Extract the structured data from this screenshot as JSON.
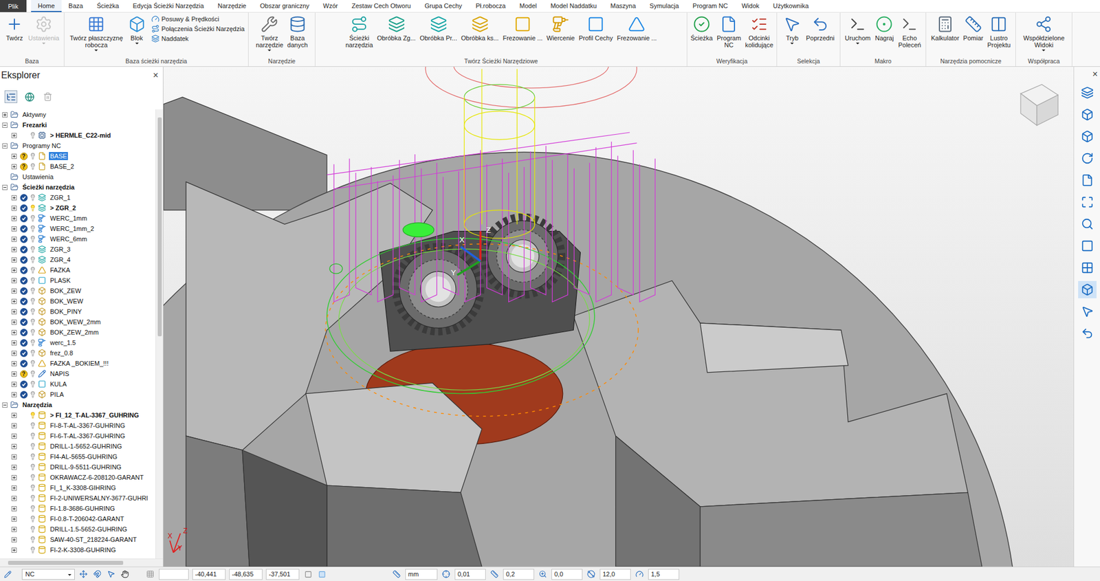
{
  "menu": {
    "file": "Plik",
    "tabs": [
      {
        "label": "Home",
        "selected": true
      },
      {
        "label": "Baza",
        "selected": false
      },
      {
        "label": "Ścieżka",
        "selected": false
      },
      {
        "label": "Edycja Ścieżki Narzędzia",
        "selected": false
      },
      {
        "label": "Narzędzie",
        "selected": false
      },
      {
        "label": "Obszar graniczny",
        "selected": false
      },
      {
        "label": "Wzór",
        "selected": false
      },
      {
        "label": "Zestaw Cech Otworu",
        "selected": false
      },
      {
        "label": "Grupa Cechy",
        "selected": false
      },
      {
        "label": "Pł.robocza",
        "selected": false
      },
      {
        "label": "Model",
        "selected": false
      },
      {
        "label": "Model Naddatku",
        "selected": false
      },
      {
        "label": "Maszyna",
        "selected": false
      },
      {
        "label": "Symulacja",
        "selected": false
      },
      {
        "label": "Program NC",
        "selected": false
      },
      {
        "label": "Widok",
        "selected": false
      },
      {
        "label": "Użytkownika",
        "selected": false
      }
    ]
  },
  "ribbon": {
    "groups": [
      {
        "title": "Baza",
        "buttons": [
          {
            "label": "Twórz",
            "disabled": false,
            "dropdown": false
          },
          {
            "label": "Ustawienia",
            "disabled": true,
            "dropdown": true
          }
        ],
        "small": []
      },
      {
        "title": "Baza ścieżki narzędzia",
        "buttons": [
          {
            "label": "Twórz płaszczyznę\nrobocza",
            "disabled": false,
            "dropdown": true
          },
          {
            "label": "Blok",
            "disabled": false,
            "dropdown": true
          }
        ],
        "small": [
          "Posuwy & Prędkości",
          "Połączenia Ścieżki Narzędzia",
          "Naddatek"
        ]
      },
      {
        "title": "Narzędzie",
        "buttons": [
          {
            "label": "Twórz\nnarzędzie",
            "disabled": false,
            "dropdown": true
          },
          {
            "label": "Baza\ndanych",
            "disabled": false,
            "dropdown": false
          }
        ],
        "small": []
      },
      {
        "title": "Twórz Ścieżki Narzędziowe",
        "buttons": [
          {
            "label": "Ścieżki\nnarzędzia",
            "disabled": false,
            "dropdown": false
          },
          {
            "label": "Obróbka Zg...",
            "disabled": false,
            "dropdown": false
          },
          {
            "label": "Obróbka Pr...",
            "disabled": false,
            "dropdown": false
          },
          {
            "label": "Obróbka ks...",
            "disabled": false,
            "dropdown": false
          },
          {
            "label": "Frezowanie ...",
            "disabled": false,
            "dropdown": false
          },
          {
            "label": "Wiercenie",
            "disabled": false,
            "dropdown": false
          },
          {
            "label": "Profil Cechy",
            "disabled": false,
            "dropdown": false
          },
          {
            "label": "Frezowanie ...",
            "disabled": false,
            "dropdown": false
          }
        ],
        "small": []
      },
      {
        "title": "Weryfikacja",
        "buttons": [
          {
            "label": "Ścieżka",
            "disabled": false,
            "dropdown": false
          },
          {
            "label": "Program\nNC",
            "disabled": false,
            "dropdown": false
          },
          {
            "label": "Odcinki\nkolidujące",
            "disabled": false,
            "dropdown": false
          }
        ],
        "small": []
      },
      {
        "title": "Selekcja",
        "buttons": [
          {
            "label": "Tryb",
            "disabled": false,
            "dropdown": true
          },
          {
            "label": "Poprzedni",
            "disabled": false,
            "dropdown": false
          }
        ],
        "small": []
      },
      {
        "title": "Makro",
        "buttons": [
          {
            "label": "Uruchom",
            "disabled": false,
            "dropdown": true
          },
          {
            "label": "Nagraj",
            "disabled": false,
            "dropdown": false
          },
          {
            "label": "Echo\nPoleceń",
            "disabled": false,
            "dropdown": false
          }
        ],
        "small": []
      },
      {
        "title": "Narzędzia pomocnicze",
        "buttons": [
          {
            "label": "Kalkulator",
            "disabled": false,
            "dropdown": false
          },
          {
            "label": "Pomiar",
            "disabled": false,
            "dropdown": false
          },
          {
            "label": "Lustro\nProjektu",
            "disabled": false,
            "dropdown": false
          }
        ],
        "small": []
      },
      {
        "title": "Współpraca",
        "buttons": [
          {
            "label": "Współdzielone\nWidoki",
            "disabled": false,
            "dropdown": true
          }
        ],
        "small": []
      }
    ]
  },
  "explorer": {
    "title": "Eksplorer",
    "close": "×",
    "items": [
      {
        "label": "Aktywny",
        "level": 0,
        "kind": "folder",
        "expandable": true,
        "expanded": false,
        "bold": false,
        "selected": false,
        "status": "none",
        "mark": "",
        "lit": false
      },
      {
        "label": "Frezarki",
        "level": 0,
        "kind": "folder",
        "expandable": true,
        "expanded": true,
        "bold": true,
        "selected": false,
        "status": "none",
        "mark": "",
        "lit": false
      },
      {
        "label": "> HERMLE_C22-mid",
        "level": 1,
        "kind": "machine",
        "expandable": true,
        "expanded": false,
        "bold": true,
        "selected": false,
        "status": "none",
        "mark": "",
        "lit": false
      },
      {
        "label": "Programy NC",
        "level": 0,
        "kind": "folder",
        "expandable": true,
        "expanded": true,
        "bold": false,
        "selected": false,
        "status": "none",
        "mark": "",
        "lit": false
      },
      {
        "label": "BASE",
        "level": 1,
        "kind": "program",
        "expandable": true,
        "expanded": false,
        "bold": false,
        "selected": true,
        "status": "unknown",
        "mark": "?",
        "lit": false
      },
      {
        "label": "BASE_2",
        "level": 1,
        "kind": "program",
        "expandable": true,
        "expanded": false,
        "bold": false,
        "selected": false,
        "status": "unknown",
        "mark": "?",
        "lit": false
      },
      {
        "label": "Ustawienia",
        "level": 0,
        "kind": "folder",
        "expandable": false,
        "expanded": false,
        "bold": false,
        "selected": false,
        "status": "none",
        "mark": "",
        "lit": false
      },
      {
        "label": "Ścieżki narzędzia",
        "level": 0,
        "kind": "folder",
        "expandable": true,
        "expanded": true,
        "bold": true,
        "selected": false,
        "status": "none",
        "mark": "",
        "lit": false
      },
      {
        "label": "ZGR_1",
        "level": 1,
        "kind": "toolpath",
        "expandable": true,
        "expanded": false,
        "bold": false,
        "selected": false,
        "status": "ok",
        "mark": "",
        "lit": false
      },
      {
        "label": "> ZGR_2",
        "level": 1,
        "kind": "toolpath",
        "expandable": true,
        "expanded": false,
        "bold": true,
        "selected": false,
        "status": "ok",
        "mark": "",
        "lit": true
      },
      {
        "label": "WERC_1mm",
        "level": 1,
        "kind": "drill",
        "expandable": true,
        "expanded": false,
        "bold": false,
        "selected": false,
        "status": "ok",
        "mark": "",
        "lit": false
      },
      {
        "label": "WERC_1mm_2",
        "level": 1,
        "kind": "drill",
        "expandable": true,
        "expanded": false,
        "bold": false,
        "selected": false,
        "status": "ok",
        "mark": "",
        "lit": false
      },
      {
        "label": "WERC_6mm",
        "level": 1,
        "kind": "drill",
        "expandable": true,
        "expanded": false,
        "bold": false,
        "selected": false,
        "status": "ok",
        "mark": "",
        "lit": false
      },
      {
        "label": "ZGR_3",
        "level": 1,
        "kind": "toolpath",
        "expandable": true,
        "expanded": false,
        "bold": false,
        "selected": false,
        "status": "ok",
        "mark": "",
        "lit": false
      },
      {
        "label": "ZGR_4",
        "level": 1,
        "kind": "toolpath",
        "expandable": true,
        "expanded": false,
        "bold": false,
        "selected": false,
        "status": "ok",
        "mark": "",
        "lit": false
      },
      {
        "label": "FAZKA",
        "level": 1,
        "kind": "chamfer",
        "expandable": true,
        "expanded": false,
        "bold": false,
        "selected": false,
        "status": "ok",
        "mark": "",
        "lit": false
      },
      {
        "label": "PLASK",
        "level": 1,
        "kind": "face",
        "expandable": true,
        "expanded": false,
        "bold": false,
        "selected": false,
        "status": "ok",
        "mark": "",
        "lit": false
      },
      {
        "label": "BOK_ZEW",
        "level": 1,
        "kind": "profile",
        "expandable": true,
        "expanded": false,
        "bold": false,
        "selected": false,
        "status": "ok",
        "mark": "",
        "lit": false
      },
      {
        "label": "BOK_WEW",
        "level": 1,
        "kind": "profile",
        "expandable": true,
        "expanded": false,
        "bold": false,
        "selected": false,
        "status": "ok",
        "mark": "",
        "lit": false
      },
      {
        "label": "BOK_PINY",
        "level": 1,
        "kind": "profile",
        "expandable": true,
        "expanded": false,
        "bold": false,
        "selected": false,
        "status": "ok",
        "mark": "",
        "lit": false
      },
      {
        "label": "BOK_WEW_2mm",
        "level": 1,
        "kind": "profile",
        "expandable": true,
        "expanded": false,
        "bold": false,
        "selected": false,
        "status": "ok",
        "mark": "",
        "lit": false
      },
      {
        "label": "BOK_ZEW_2mm",
        "level": 1,
        "kind": "profile",
        "expandable": true,
        "expanded": false,
        "bold": false,
        "selected": false,
        "status": "ok",
        "mark": "",
        "lit": false
      },
      {
        "label": "werc_1.5",
        "level": 1,
        "kind": "drill",
        "expandable": true,
        "expanded": false,
        "bold": false,
        "selected": false,
        "status": "ok",
        "mark": "",
        "lit": false
      },
      {
        "label": "frez_0.8",
        "level": 1,
        "kind": "profile",
        "expandable": true,
        "expanded": false,
        "bold": false,
        "selected": false,
        "status": "ok",
        "mark": "",
        "lit": false
      },
      {
        "label": "FAZKA _BOKIEM_!!!",
        "level": 1,
        "kind": "chamfer",
        "expandable": true,
        "expanded": false,
        "bold": false,
        "selected": false,
        "status": "ok",
        "mark": "",
        "lit": false
      },
      {
        "label": "NAPIS",
        "level": 1,
        "kind": "engrave",
        "expandable": true,
        "expanded": false,
        "bold": false,
        "selected": false,
        "status": "unknown",
        "mark": "?",
        "lit": false
      },
      {
        "label": "KULA",
        "level": 1,
        "kind": "face",
        "expandable": true,
        "expanded": false,
        "bold": false,
        "selected": false,
        "status": "ok",
        "mark": "",
        "lit": false
      },
      {
        "label": "PILA",
        "level": 1,
        "kind": "profile",
        "expandable": true,
        "expanded": false,
        "bold": false,
        "selected": false,
        "status": "ok",
        "mark": "",
        "lit": false
      },
      {
        "label": "Narzędzia",
        "level": 0,
        "kind": "folder",
        "expandable": true,
        "expanded": true,
        "bold": true,
        "selected": false,
        "status": "none",
        "mark": "",
        "lit": false
      },
      {
        "label": "> FI_12_T-AL-3367_GUHRING",
        "level": 1,
        "kind": "tool",
        "expandable": true,
        "expanded": false,
        "bold": true,
        "selected": false,
        "status": "none",
        "mark": "",
        "lit": true
      },
      {
        "label": "FI-8-T-AL-3367-GUHRING",
        "level": 1,
        "kind": "tool",
        "expandable": true,
        "expanded": false,
        "bold": false,
        "selected": false,
        "status": "none",
        "mark": "",
        "lit": false
      },
      {
        "label": "FI-6-T-AL-3367-GUHRING",
        "level": 1,
        "kind": "tool",
        "expandable": true,
        "expanded": false,
        "bold": false,
        "selected": false,
        "status": "none",
        "mark": "",
        "lit": false
      },
      {
        "label": "DRILL-1-5652-GUHRING",
        "level": 1,
        "kind": "tool",
        "expandable": true,
        "expanded": false,
        "bold": false,
        "selected": false,
        "status": "none",
        "mark": "",
        "lit": false
      },
      {
        "label": "FI4-AL-5655-GUHRING",
        "level": 1,
        "kind": "tool",
        "expandable": true,
        "expanded": false,
        "bold": false,
        "selected": false,
        "status": "none",
        "mark": "",
        "lit": false
      },
      {
        "label": "DRILL-9-5511-GUHRING",
        "level": 1,
        "kind": "tool",
        "expandable": true,
        "expanded": false,
        "bold": false,
        "selected": false,
        "status": "none",
        "mark": "",
        "lit": false
      },
      {
        "label": "OKRAWACZ-6-208120-GARANT",
        "level": 1,
        "kind": "tool",
        "expandable": true,
        "expanded": false,
        "bold": false,
        "selected": false,
        "status": "none",
        "mark": "",
        "lit": false
      },
      {
        "label": "FI_1_K-3308-GIHRING",
        "level": 1,
        "kind": "tool",
        "expandable": true,
        "expanded": false,
        "bold": false,
        "selected": false,
        "status": "none",
        "mark": "",
        "lit": false
      },
      {
        "label": "FI-2-UNIWERSALNY-3677-GUHRI",
        "level": 1,
        "kind": "tool",
        "expandable": true,
        "expanded": false,
        "bold": false,
        "selected": false,
        "status": "none",
        "mark": "",
        "lit": false
      },
      {
        "label": "FI-1.8-3686-GUHRING",
        "level": 1,
        "kind": "tool",
        "expandable": true,
        "expanded": false,
        "bold": false,
        "selected": false,
        "status": "none",
        "mark": "",
        "lit": false
      },
      {
        "label": "FI-0.8-T-206042-GARANT",
        "level": 1,
        "kind": "tool",
        "expandable": true,
        "expanded": false,
        "bold": false,
        "selected": false,
        "status": "none",
        "mark": "",
        "lit": false
      },
      {
        "label": "DRILL-1.5-5652-GUHRING",
        "level": 1,
        "kind": "tool",
        "expandable": true,
        "expanded": false,
        "bold": false,
        "selected": false,
        "status": "none",
        "mark": "",
        "lit": false
      },
      {
        "label": "SAW-40-ST_218224-GARANT",
        "level": 1,
        "kind": "tool",
        "expandable": true,
        "expanded": false,
        "bold": false,
        "selected": false,
        "status": "none",
        "mark": "",
        "lit": false
      },
      {
        "label": "FI-2-K-3308-GUHRING",
        "level": 1,
        "kind": "tool",
        "expandable": true,
        "expanded": false,
        "bold": false,
        "selected": false,
        "status": "none",
        "mark": "",
        "lit": false
      }
    ]
  },
  "viewport": {
    "triad": {
      "x": "X",
      "y": "Y",
      "z": "Z"
    }
  },
  "right_panel": {
    "close": "×"
  },
  "status_bar": {
    "mode": "NC",
    "coords": [
      "-40,441",
      "-48,635",
      "-37,501"
    ],
    "unit": "mm",
    "fields": [
      "0,01",
      "0,2",
      "0,0",
      "12,0",
      "1,5"
    ]
  }
}
